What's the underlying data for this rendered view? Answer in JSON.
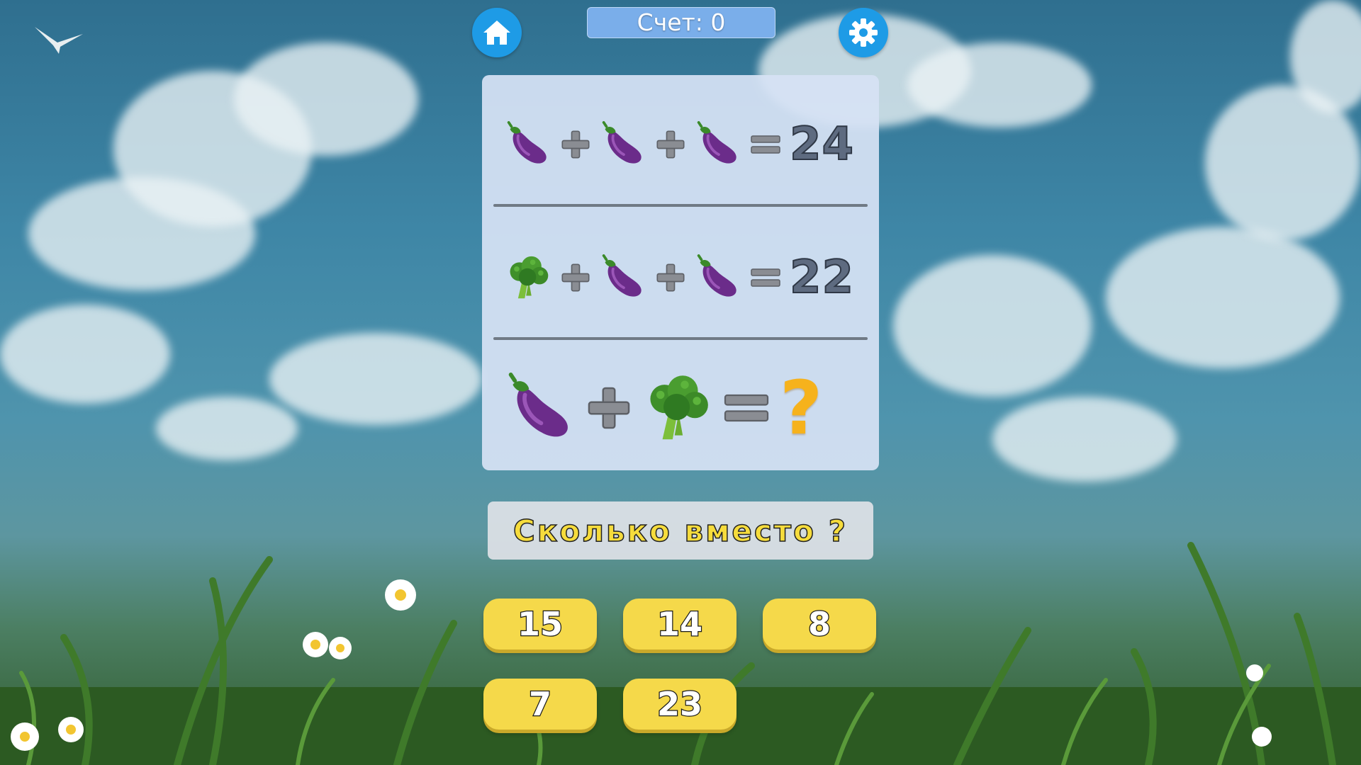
{
  "game": {
    "score_text": "Счет: 0",
    "question": "Сколько вместо ?",
    "equations": [
      {
        "terms": [
          "eggplant-icon",
          "eggplant-icon",
          "eggplant-icon"
        ],
        "operator": "+",
        "equals": "=",
        "result": "24"
      },
      {
        "terms": [
          "broccoli-icon",
          "eggplant-icon",
          "eggplant-icon"
        ],
        "operator": "+",
        "equals": "=",
        "result": "22"
      },
      {
        "terms": [
          "eggplant-icon",
          "broccoli-icon"
        ],
        "operator": "+",
        "equals": "=",
        "result": "?"
      }
    ],
    "answers": [
      "15",
      "14",
      "8",
      "7",
      "23"
    ]
  },
  "toolbar": {
    "home_icon": "home-icon",
    "settings_icon": "gear-icon"
  },
  "colors": {
    "button_blue": "#1e9be6",
    "score_bg": "#7aaeea",
    "answer_yellow": "#f5d94a",
    "question_mark": "#f6b21c"
  }
}
